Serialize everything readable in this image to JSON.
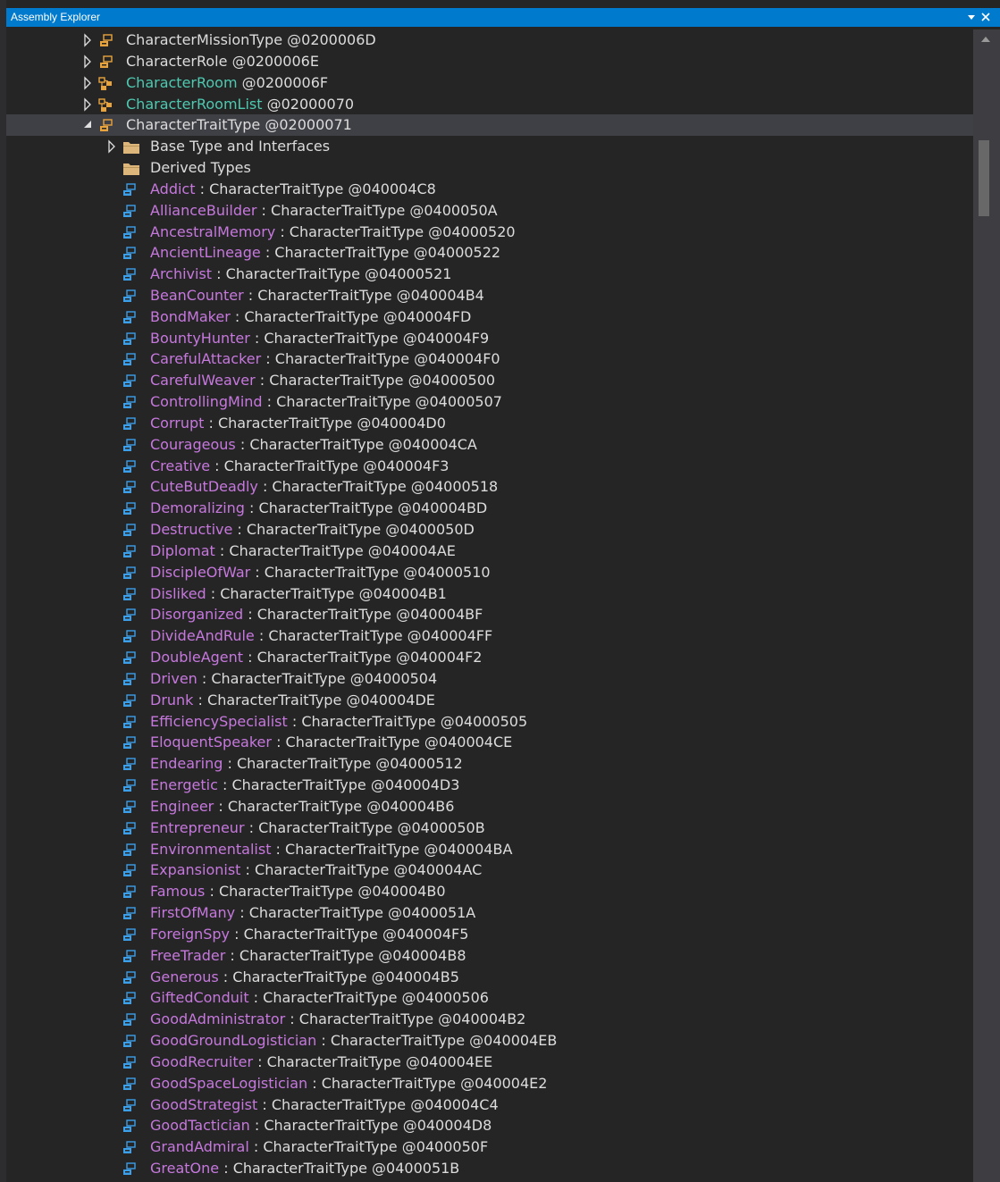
{
  "window": {
    "title": "Assembly Explorer",
    "dropdown_icon": "chevron-down-icon",
    "close_icon": "close-icon"
  },
  "colors": {
    "accent": "#007acc",
    "background": "#252526",
    "text": "#dcdcdc",
    "sealed_type": "#4ec9b0",
    "field": "#c678dd",
    "type_icon": "#e8a33d",
    "field_icon": "#3c9fe8",
    "folder_icon": "#dcb67a"
  },
  "tree": {
    "types": [
      {
        "name": "CharacterMissionType",
        "token": "@0200006D",
        "expanded": false,
        "style": "type",
        "icon": "enum-type-icon"
      },
      {
        "name": "CharacterRole",
        "token": "@0200006E",
        "expanded": false,
        "style": "type",
        "icon": "enum-type-icon"
      },
      {
        "name": "CharacterRoom",
        "token": "@0200006F",
        "expanded": false,
        "style": "sealed",
        "icon": "class-icon"
      },
      {
        "name": "CharacterRoomList",
        "token": "@02000070",
        "expanded": false,
        "style": "sealed",
        "icon": "class-icon"
      },
      {
        "name": "CharacterTraitType",
        "token": "@02000071",
        "expanded": true,
        "style": "type",
        "icon": "enum-type-icon"
      }
    ],
    "folders": [
      {
        "label": "Base Type and Interfaces",
        "expandable": true
      },
      {
        "label": "Derived Types",
        "expandable": false
      }
    ],
    "field_type": "CharacterTraitType",
    "fields": [
      {
        "name": "Addict",
        "token": "@040004C8"
      },
      {
        "name": "AllianceBuilder",
        "token": "@0400050A"
      },
      {
        "name": "AncestralMemory",
        "token": "@04000520"
      },
      {
        "name": "AncientLineage",
        "token": "@04000522"
      },
      {
        "name": "Archivist",
        "token": "@04000521"
      },
      {
        "name": "BeanCounter",
        "token": "@040004B4"
      },
      {
        "name": "BondMaker",
        "token": "@040004FD"
      },
      {
        "name": "BountyHunter",
        "token": "@040004F9"
      },
      {
        "name": "CarefulAttacker",
        "token": "@040004F0"
      },
      {
        "name": "CarefulWeaver",
        "token": "@04000500"
      },
      {
        "name": "ControllingMind",
        "token": "@04000507"
      },
      {
        "name": "Corrupt",
        "token": "@040004D0"
      },
      {
        "name": "Courageous",
        "token": "@040004CA"
      },
      {
        "name": "Creative",
        "token": "@040004F3"
      },
      {
        "name": "CuteButDeadly",
        "token": "@04000518"
      },
      {
        "name": "Demoralizing",
        "token": "@040004BD"
      },
      {
        "name": "Destructive",
        "token": "@0400050D"
      },
      {
        "name": "Diplomat",
        "token": "@040004AE"
      },
      {
        "name": "DiscipleOfWar",
        "token": "@04000510"
      },
      {
        "name": "Disliked",
        "token": "@040004B1"
      },
      {
        "name": "Disorganized",
        "token": "@040004BF"
      },
      {
        "name": "DivideAndRule",
        "token": "@040004FF"
      },
      {
        "name": "DoubleAgent",
        "token": "@040004F2"
      },
      {
        "name": "Driven",
        "token": "@04000504"
      },
      {
        "name": "Drunk",
        "token": "@040004DE"
      },
      {
        "name": "EfficiencySpecialist",
        "token": "@04000505"
      },
      {
        "name": "EloquentSpeaker",
        "token": "@040004CE"
      },
      {
        "name": "Endearing",
        "token": "@04000512"
      },
      {
        "name": "Energetic",
        "token": "@040004D3"
      },
      {
        "name": "Engineer",
        "token": "@040004B6"
      },
      {
        "name": "Entrepreneur",
        "token": "@0400050B"
      },
      {
        "name": "Environmentalist",
        "token": "@040004BA"
      },
      {
        "name": "Expansionist",
        "token": "@040004AC"
      },
      {
        "name": "Famous",
        "token": "@040004B0"
      },
      {
        "name": "FirstOfMany",
        "token": "@0400051A"
      },
      {
        "name": "ForeignSpy",
        "token": "@040004F5"
      },
      {
        "name": "FreeTrader",
        "token": "@040004B8"
      },
      {
        "name": "Generous",
        "token": "@040004B5"
      },
      {
        "name": "GiftedConduit",
        "token": "@04000506"
      },
      {
        "name": "GoodAdministrator",
        "token": "@040004B2"
      },
      {
        "name": "GoodGroundLogistician",
        "token": "@040004EB"
      },
      {
        "name": "GoodRecruiter",
        "token": "@040004EE"
      },
      {
        "name": "GoodSpaceLogistician",
        "token": "@040004E2"
      },
      {
        "name": "GoodStrategist",
        "token": "@040004C4"
      },
      {
        "name": "GoodTactician",
        "token": "@040004D8"
      },
      {
        "name": "GrandAdmiral",
        "token": "@0400050F"
      },
      {
        "name": "GreatOne",
        "token": "@0400051B"
      }
    ]
  },
  "scrollbar": {
    "up_icon": "scroll-up-arrow-icon",
    "position_fraction": 0.08
  }
}
